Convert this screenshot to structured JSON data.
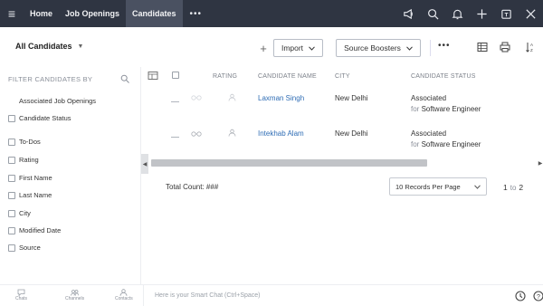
{
  "topnav": {
    "tabs": [
      {
        "label": "Home"
      },
      {
        "label": "Job Openings"
      },
      {
        "label": "Candidates"
      }
    ],
    "more": "•••"
  },
  "toolbar": {
    "view_label": "All Candidates",
    "add": "+",
    "import_label": "Import",
    "boosters_label": "Source Boosters",
    "more": "•••"
  },
  "sidebar": {
    "title": "FILTER CANDIDATES BY",
    "items": [
      {
        "label": "Associated Job Openings"
      },
      {
        "label": "Candidate Status"
      },
      {
        "label": "To-Dos"
      },
      {
        "label": "Rating"
      },
      {
        "label": "First Name"
      },
      {
        "label": "Last Name"
      },
      {
        "label": "City"
      },
      {
        "label": "Modified Date"
      },
      {
        "label": "Source"
      }
    ]
  },
  "table": {
    "headers": {
      "rating": "RATING",
      "name": "CANDIDATE NAME",
      "city": "CITY",
      "status": "CANDIDATE STATUS"
    },
    "rows": [
      {
        "name": "Laxman Singh",
        "city": "New Delhi",
        "status": "Associated",
        "for_prefix": "for",
        "job": "Software Engineer"
      },
      {
        "name": "Intekhab Alam",
        "city": "New Delhi",
        "status": "Associated",
        "for_prefix": "for",
        "job": "Software Engineer"
      }
    ],
    "total_label": "Total Count: ###",
    "per_page": "10 Records Per Page",
    "pager_from": "1",
    "pager_to_word": "to",
    "pager_to": "2"
  },
  "footer": {
    "chats": "Chats",
    "channels": "Channels",
    "contacts": "Contacts",
    "smart_chat": "Here is your Smart Chat (Ctrl+Space)"
  },
  "colors": {
    "topbar": "#2f3542",
    "active_tab": "#4a5161",
    "link": "#2f6db5"
  }
}
